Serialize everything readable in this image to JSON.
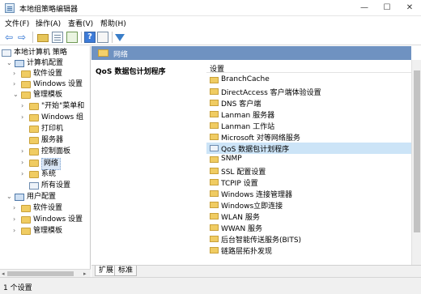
{
  "window": {
    "title": "本地组策略编辑器",
    "icon": "gpedit-app-icon",
    "controls": {
      "minimize": "—",
      "maximize": "☐",
      "close": "✕"
    }
  },
  "menu": {
    "items": [
      "文件(F)",
      "操作(A)",
      "查看(V)",
      "帮助(H)"
    ]
  },
  "toolbar": {
    "icons": [
      "back-arrow-icon",
      "forward-arrow-icon",
      "up-folder-icon",
      "show-hide-tree-icon",
      "export-list-icon",
      "help-icon",
      "properties-icon",
      "filter-icon"
    ],
    "back_glyph": "⇦",
    "forward_glyph": "⇨",
    "help_glyph": "?"
  },
  "tree": {
    "root": "本地计算机 策略",
    "computer_config": "计算机配置",
    "software_settings": "软件设置",
    "windows_settings": "Windows 设置",
    "admin_templates": "管理模板",
    "start_menu": "\"开始\"菜单和",
    "windows_components": "Windows 组",
    "printers": "打印机",
    "server": "服务器",
    "control_panel": "控制面板",
    "network": "网络",
    "system": "系统",
    "all_settings": "所有设置",
    "user_config": "用户配置",
    "user_software_settings": "软件设置",
    "user_windows_settings": "Windows 设置",
    "user_admin_templates": "管理模板",
    "expanders": {
      "open": "⌄",
      "closed": "›"
    }
  },
  "right": {
    "header": "网络",
    "description_title": "QoS 数据包计划程序",
    "column_header": "设置",
    "items": [
      "BranchCache",
      "DirectAccess 客户端体验设置",
      "DNS 客户端",
      "Lanman 服务器",
      "Lanman 工作站",
      "Microsoft 对等网络服务",
      "QoS 数据包计划程序",
      "SNMP",
      "SSL 配置设置",
      "TCPIP 设置",
      "Windows 连接管理器",
      "Windows立即连接",
      "WLAN 服务",
      "WWAN 服务",
      "后台智能传送服务(BITS)",
      "链路层拓扑发现"
    ],
    "selected_index": 6
  },
  "tabs": {
    "extended": "扩展",
    "standard": "标准"
  },
  "scroll": {
    "left": "◂",
    "right": "▸"
  },
  "status": {
    "text": "1 个设置"
  },
  "colors": {
    "header_band": "#6f92c1",
    "selection": "#cce4f7",
    "folder": "#f0cc62"
  }
}
